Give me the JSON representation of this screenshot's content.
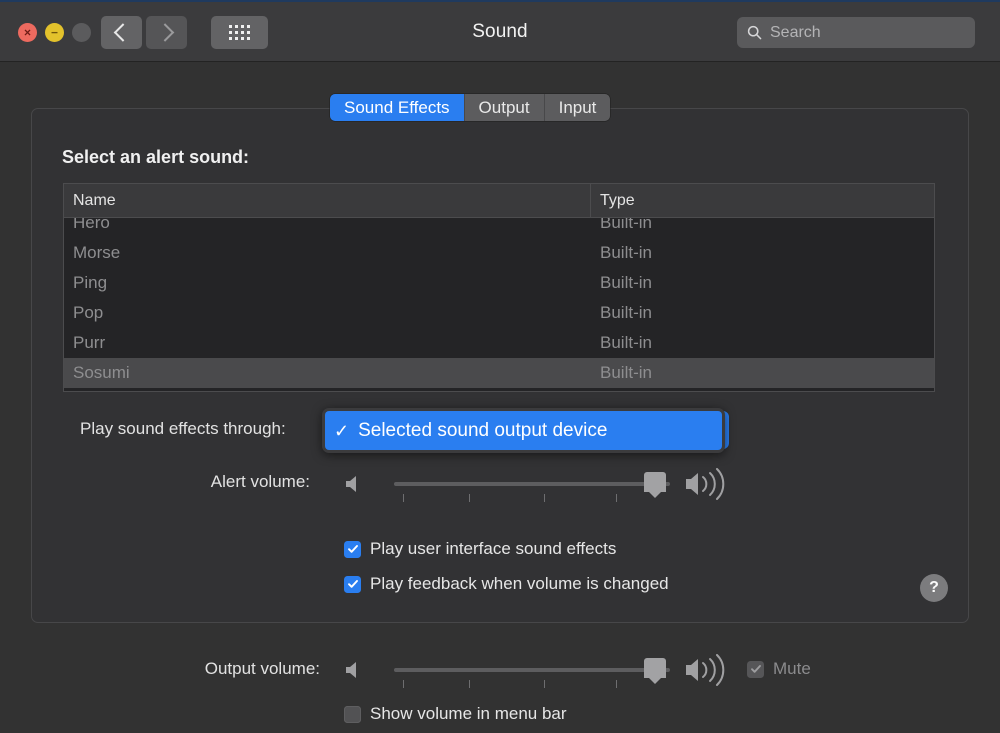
{
  "window": {
    "title": "Sound",
    "traffic_lights": [
      {
        "name": "close",
        "glyph": "×",
        "color": "#ed6a5f"
      },
      {
        "name": "minimize",
        "glyph": "−",
        "color": "#e3c22c"
      },
      {
        "name": "zoom",
        "glyph": "",
        "color": "#5b5b5d"
      }
    ]
  },
  "toolbar": {
    "back_icon": "chevron-left-icon",
    "forward_icon": "chevron-right-icon",
    "grid_icon": "show-all-grid-icon",
    "search": {
      "icon": "search-icon",
      "value": "",
      "placeholder": "Search"
    }
  },
  "tabs": [
    {
      "label": "Sound Effects",
      "active": true
    },
    {
      "label": "Output",
      "active": false
    },
    {
      "label": "Input",
      "active": false
    }
  ],
  "main": {
    "section_label": "Select an alert sound:",
    "table": {
      "columns": [
        "Name",
        "Type"
      ],
      "rows": [
        {
          "name": "Hero",
          "type": "Built-in",
          "selected": false
        },
        {
          "name": "Morse",
          "type": "Built-in",
          "selected": false
        },
        {
          "name": "Ping",
          "type": "Built-in",
          "selected": false
        },
        {
          "name": "Pop",
          "type": "Built-in",
          "selected": false
        },
        {
          "name": "Purr",
          "type": "Built-in",
          "selected": false
        },
        {
          "name": "Sosumi",
          "type": "Built-in",
          "selected": true
        }
      ]
    },
    "play_through": {
      "label": "Play sound effects through:",
      "selected_value": "Selected sound output device",
      "checkmark": "✓",
      "menu_open": true
    },
    "alert_volume": {
      "label": "Alert volume:",
      "value_percent": 92,
      "mute_icon": "speaker-muted-icon",
      "loud_icon": "speaker-loud-icon",
      "tick_count": 4
    },
    "checkboxes": [
      {
        "label": "Play user interface sound effects",
        "checked": true,
        "enabled": true
      },
      {
        "label": "Play feedback when volume is changed",
        "checked": true,
        "enabled": true
      }
    ],
    "help_button": {
      "label": "?",
      "icon": "help-icon"
    }
  },
  "footer": {
    "output_volume": {
      "label": "Output volume:",
      "value_percent": 84,
      "mute_icon": "speaker-muted-icon",
      "loud_icon": "speaker-loud-icon",
      "tick_count": 4
    },
    "mute": {
      "label": "Mute",
      "checked": true,
      "enabled": false
    },
    "show_in_menu_bar": {
      "label": "Show volume in menu bar",
      "checked": false,
      "enabled": true
    }
  },
  "colors": {
    "accent_blue": "#2a7ef0",
    "window_bg": "#323234",
    "titlebar_bg": "#3b3b3d",
    "table_bg": "#242426",
    "row_selected": "#4a4a4c",
    "text_primary": "#e6e6e6",
    "text_dim": "#8e8e90"
  }
}
